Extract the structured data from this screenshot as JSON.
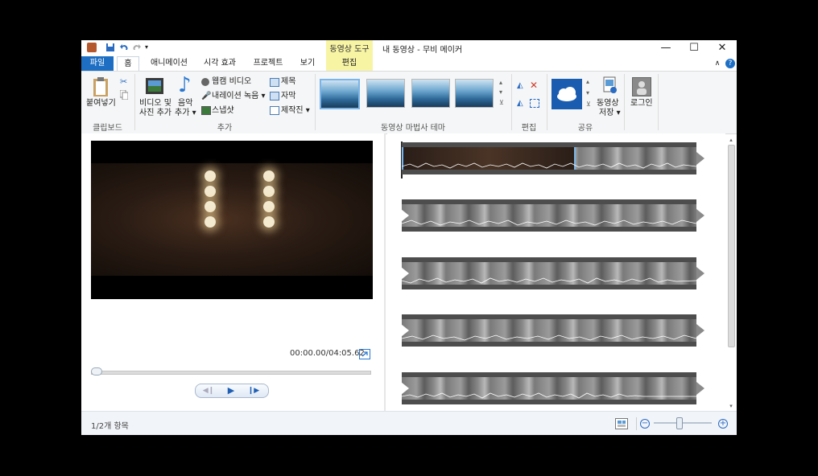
{
  "window": {
    "title": "내 동영상 - 무비 메이커",
    "context_tab_group": "동영상 도구",
    "controls": {
      "minimize": "—",
      "maximize": "☐",
      "close": "✕"
    }
  },
  "tabs": [
    "파일",
    "홈",
    "애니메이션",
    "시각 효과",
    "프로젝트",
    "보기",
    "편집"
  ],
  "ribbon": {
    "clipboard": {
      "paste": "붙여넣기",
      "group": "클립보드"
    },
    "add": {
      "add_video_line1": "비디오 및",
      "add_video_line2": "사진 추가",
      "music_line1": "음악",
      "music_line2": "추가 ▾",
      "webcam": "웹캠 비디오",
      "narration": "내레이션 녹음 ▾",
      "snapshot": "스냅샷",
      "title": "제목",
      "caption": "자막",
      "credits": "제작진 ▾",
      "group": "추가"
    },
    "themes": {
      "group": "동영상 마법사 테마"
    },
    "edit": {
      "group": "편집"
    },
    "share": {
      "save_line1": "동영상",
      "save_line2": "저장 ▾",
      "group": "공유"
    },
    "login": "로그인"
  },
  "preview": {
    "time": "00:00.00/04:05.62",
    "seek_fraction": 0.0
  },
  "status": {
    "items": "1/2개 항목",
    "zoom_fraction": 0.43
  },
  "colors": {
    "file_tab": "#1e6fc4",
    "context_tab": "#f7f4a4",
    "onedrive": "#1a5db0",
    "selection": "#7ab4e8"
  }
}
